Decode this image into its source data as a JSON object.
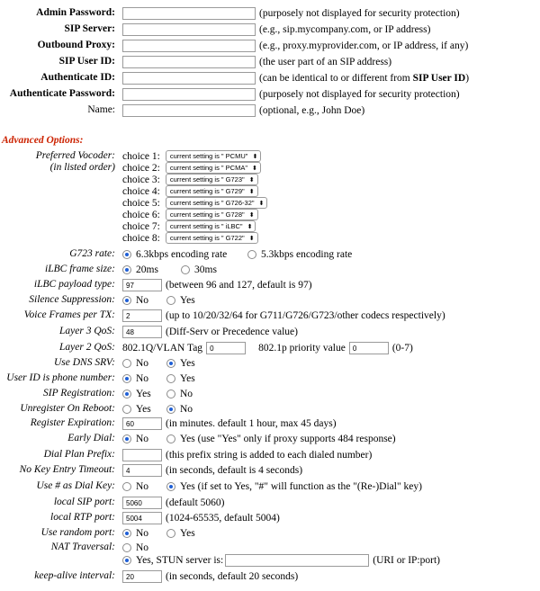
{
  "account": {
    "admin_password": {
      "label": "Admin Password:",
      "hint": "(purposely not displayed for security protection)"
    },
    "sip_server": {
      "label": "SIP Server:",
      "hint": "(e.g., sip.mycompany.com, or IP address)"
    },
    "outbound_proxy": {
      "label": "Outbound Proxy:",
      "hint": "(e.g., proxy.myprovider.com, or IP address, if any)"
    },
    "sip_user_id": {
      "label": "SIP User ID:",
      "hint": "(the user part of an SIP address)"
    },
    "authenticate_id": {
      "label": "Authenticate ID:",
      "hint_prefix": "(can be identical to or different from ",
      "hint_bold": "SIP User ID",
      "hint_suffix": ")"
    },
    "authenticate_password": {
      "label": "Authenticate Password:",
      "hint": "(purposely not displayed for security protection)"
    },
    "name": {
      "label": "Name:",
      "hint": "(optional, e.g., John Doe)"
    }
  },
  "advanced": {
    "title": "Advanced Options:",
    "vocoder": {
      "label1": "Preferred Vocoder:",
      "label2": "(in listed order)",
      "choices": [
        {
          "label": "choice 1:",
          "value": "current setting is \" PCMU\""
        },
        {
          "label": "choice 2:",
          "value": "current setting is \" PCMA\""
        },
        {
          "label": "choice 3:",
          "value": "current setting is \" G723\""
        },
        {
          "label": "choice 4:",
          "value": "current setting is \" G729\""
        },
        {
          "label": "choice 5:",
          "value": "current setting is \" G726-32\""
        },
        {
          "label": "choice 6:",
          "value": "current setting is \" G728\""
        },
        {
          "label": "choice 7:",
          "value": "current setting is \" iLBC\""
        },
        {
          "label": "choice 8:",
          "value": "current setting is \" G722\""
        }
      ]
    },
    "g723_rate": {
      "label": "G723 rate:",
      "opt1": "6.3kbps encoding rate",
      "opt2": "5.3kbps encoding rate"
    },
    "ilbc_frame": {
      "label": "iLBC frame size:",
      "opt1": "20ms",
      "opt2": "30ms"
    },
    "ilbc_payload": {
      "label": "iLBC payload type:",
      "value": "97",
      "hint": "(between 96 and 127, default is 97)"
    },
    "silence": {
      "label": "Silence Suppression:",
      "opt1": "No",
      "opt2": "Yes"
    },
    "voice_frames": {
      "label": "Voice Frames per TX:",
      "value": "2",
      "hint": "(up to 10/20/32/64 for G711/G726/G723/other codecs respectively)"
    },
    "layer3": {
      "label": "Layer 3 QoS:",
      "value": "48",
      "hint": "(Diff-Serv or Precedence value)"
    },
    "layer2": {
      "label": "Layer 2 QoS:",
      "text1": "802.1Q/VLAN Tag",
      "value1": "0",
      "text2": "802.1p priority value",
      "value2": "0",
      "hint": "(0-7)"
    },
    "dns_srv": {
      "label": "Use DNS SRV:",
      "opt1": "No",
      "opt2": "Yes"
    },
    "userid_phone": {
      "label": "User ID is phone number:",
      "opt1": "No",
      "opt2": "Yes"
    },
    "sip_reg": {
      "label": "SIP Registration:",
      "opt1": "Yes",
      "opt2": "No"
    },
    "unregister": {
      "label": "Unregister On Reboot:",
      "opt1": "Yes",
      "opt2": "No"
    },
    "reg_exp": {
      "label": "Register Expiration:",
      "value": "60",
      "hint": "(in minutes. default 1 hour, max 45 days)"
    },
    "early_dial": {
      "label": "Early Dial:",
      "opt1": "No",
      "opt2": "Yes (use \"Yes\" only if proxy supports 484 response)"
    },
    "dial_prefix": {
      "label": "Dial Plan Prefix:",
      "value": "",
      "hint": "(this prefix string is added to each dialed number)"
    },
    "no_key_timeout": {
      "label": "No Key Entry Timeout:",
      "value": "4",
      "hint": "(in seconds, default is 4 seconds)"
    },
    "hash_dial": {
      "label": "Use # as Dial Key:",
      "opt1": "No",
      "opt2": "Yes (if set to Yes, \"#\" will function as the \"(Re-)Dial\" key)"
    },
    "local_sip": {
      "label": "local SIP port:",
      "value": "5060",
      "hint": "(default 5060)"
    },
    "local_rtp": {
      "label": "local RTP port:",
      "value": "5004",
      "hint": "(1024-65535, default 5004)"
    },
    "random_port": {
      "label": "Use random port:",
      "opt1": "No",
      "opt2": "Yes"
    },
    "nat": {
      "label": "NAT Traversal:",
      "opt1": "No",
      "opt2": "Yes, STUN server is:",
      "hint": "(URI or IP:port)"
    },
    "keepalive": {
      "label": "keep-alive interval:",
      "value": "20",
      "hint": "(in seconds, default 20 seconds)"
    }
  },
  "colors": {
    "section": "#cc2200",
    "radio_on": "#1f5fd6"
  }
}
